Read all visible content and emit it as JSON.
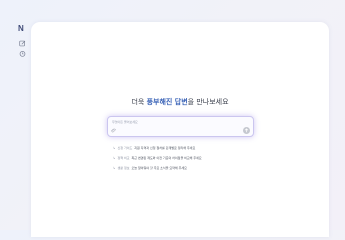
{
  "app": {
    "logo_text": "N"
  },
  "sidebar": {
    "icons": [
      {
        "name": "edit-icon"
      },
      {
        "name": "history-icon"
      }
    ]
  },
  "main": {
    "headline_prefix": "더욱",
    "headline_highlight": "풍부해진 답변",
    "headline_suffix": "을 만나보세요",
    "search": {
      "placeholder": "무엇이든 물어보세요"
    },
    "suggestions": [
      {
        "tag": "신청 가이드",
        "text": "지원 자격과 신청 절차를 단계별로 정리해 주세요"
      },
      {
        "tag": "정책 비교",
        "text": "최근 변경된 제도와 이전 기준의 차이점을 비교해 주세요"
      },
      {
        "tag": "생활 정보",
        "text": "오늘 알아둬야 할 주요 소식을 요약해 주세요"
      }
    ]
  },
  "colors": {
    "accent": "#3d65b8",
    "glow": "#b9a9f0",
    "panel": "#ffffff"
  }
}
